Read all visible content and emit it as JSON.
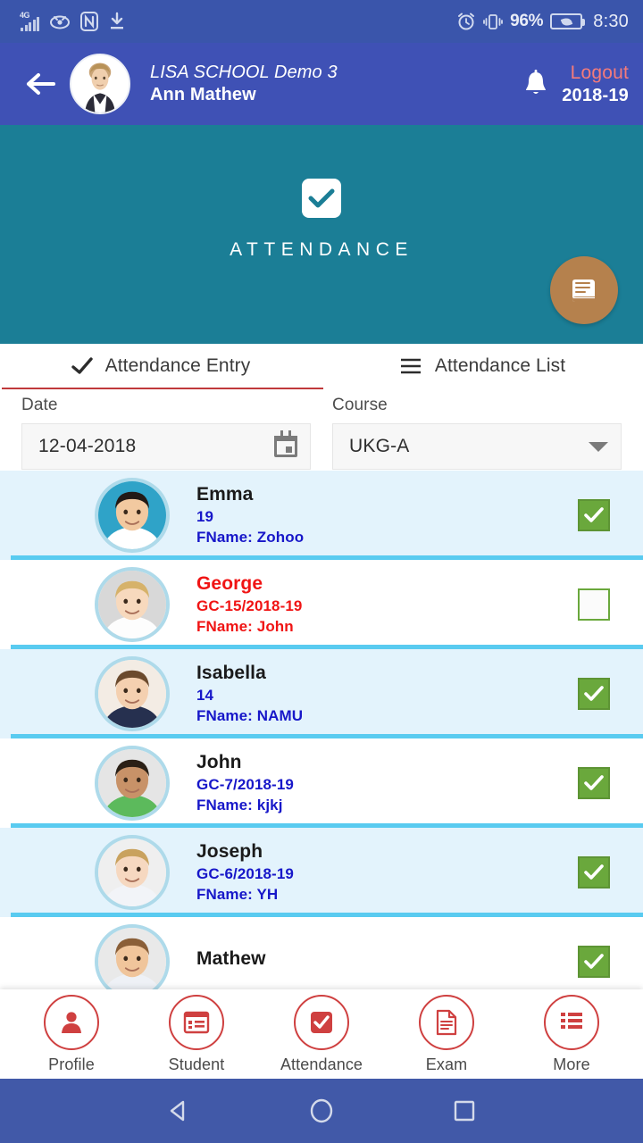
{
  "status_bar": {
    "network": "4G",
    "battery_percent": "96%",
    "time": "8:30",
    "icons": [
      "signal-icon",
      "eye-icon",
      "nfc-icon",
      "download-icon",
      "alarm-icon",
      "vibrate-icon",
      "battery-icon"
    ]
  },
  "header": {
    "back_icon": "back-arrow-icon",
    "avatar": "user-avatar",
    "school_name": "LISA SCHOOL Demo 3",
    "user_name": "Ann Mathew",
    "bell_icon": "bell-icon",
    "logout_label": "Logout",
    "academic_year": "2018-19",
    "bg_color": "#3f51b5",
    "logout_color": "#f47b7b"
  },
  "banner": {
    "icon": "checkbox-check-icon",
    "title": "ATTENDANCE",
    "bg_color": "#1b7e96",
    "fab_icon": "book-icon",
    "fab_color": "#b5814d"
  },
  "tabs": [
    {
      "label": "Attendance Entry",
      "icon": "check-icon",
      "active": true
    },
    {
      "label": "Attendance List",
      "icon": "hamburger-list-icon",
      "active": false
    }
  ],
  "tab_indicator_color": "#c0393b",
  "form": {
    "date": {
      "label": "Date",
      "value": "12-04-2018",
      "icon": "calendar-icon"
    },
    "course": {
      "label": "Course",
      "value": "UKG-A",
      "icon": "chevron-down-icon"
    }
  },
  "students": [
    {
      "name": "Emma",
      "id": "19",
      "father": "FName: Zohoo",
      "present": true,
      "highlight": true,
      "absent": false
    },
    {
      "name": "George",
      "id": "GC-15/2018-19",
      "father": "FName: John",
      "present": false,
      "highlight": false,
      "absent": true
    },
    {
      "name": "Isabella",
      "id": "14",
      "father": "FName: NAMU",
      "present": true,
      "highlight": true,
      "absent": false
    },
    {
      "name": "John",
      "id": "GC-7/2018-19",
      "father": "FName: kjkj",
      "present": true,
      "highlight": false,
      "absent": false
    },
    {
      "name": "Joseph",
      "id": "GC-6/2018-19",
      "father": "FName: YH",
      "present": true,
      "highlight": true,
      "absent": false
    },
    {
      "name": "Mathew",
      "id": "",
      "father": "",
      "present": true,
      "highlight": false,
      "absent": false
    }
  ],
  "colors": {
    "row_highlight": "#e3f3fc",
    "row_divider": "#59cbf0",
    "checkbox_checked": "#6aa83c",
    "student_id_text": "#1717c9",
    "absent_text": "#f01414"
  },
  "bottom_nav": [
    {
      "label": "Profile",
      "icon": "person-icon"
    },
    {
      "label": "Student",
      "icon": "list-card-icon"
    },
    {
      "label": "Attendance",
      "icon": "check-square-icon"
    },
    {
      "label": "Exam",
      "icon": "document-icon"
    },
    {
      "label": "More",
      "icon": "list-lines-icon"
    }
  ],
  "bottom_nav_color": "#cf4040",
  "android_nav": {
    "back": "android-back-icon",
    "home": "android-home-icon",
    "recents": "android-recents-icon",
    "bg_color": "#4159a8"
  }
}
